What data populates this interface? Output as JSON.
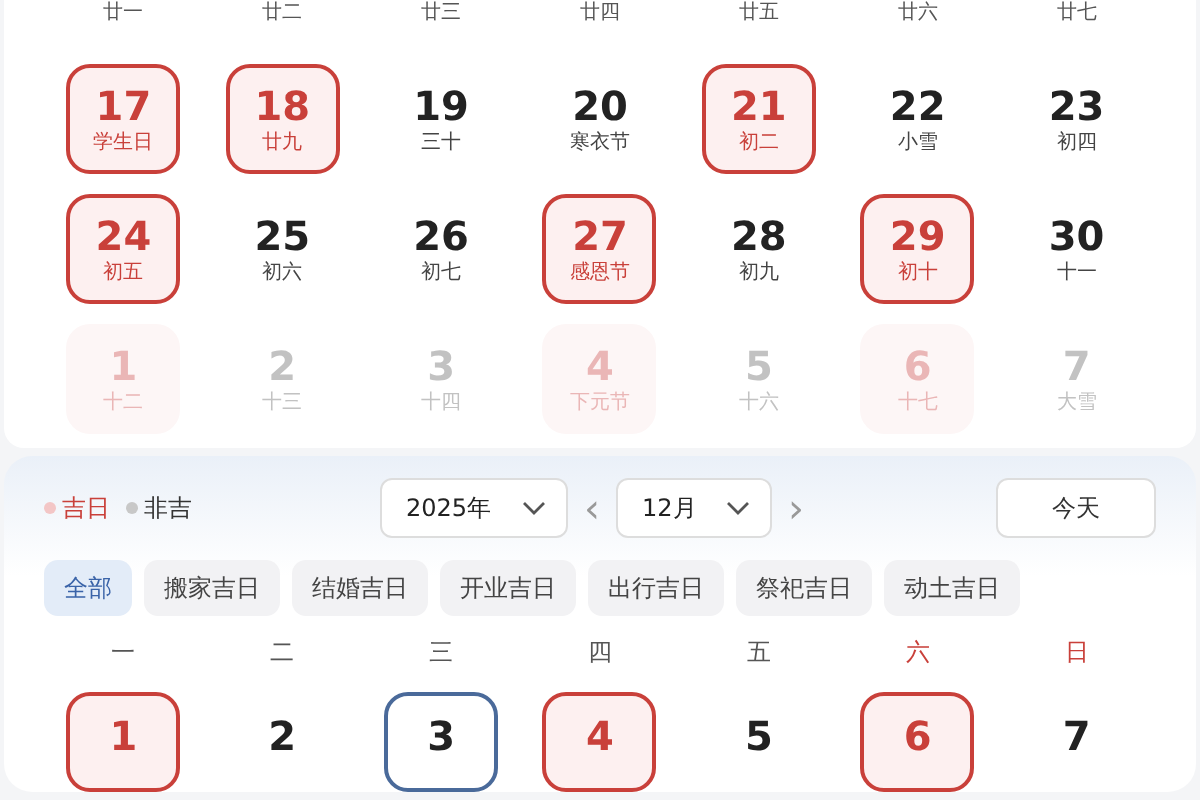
{
  "prev_month": {
    "top_lunar": [
      "廿一",
      "廿二",
      "廿三",
      "廿四",
      "廿五",
      "廿六",
      "廿七"
    ],
    "weeks": [
      [
        {
          "day": "17",
          "lunar": "学生日",
          "auspicious": true,
          "outside": false,
          "today": false
        },
        {
          "day": "18",
          "lunar": "廿九",
          "auspicious": true,
          "outside": false,
          "today": false
        },
        {
          "day": "19",
          "lunar": "三十",
          "auspicious": false,
          "outside": false,
          "today": false
        },
        {
          "day": "20",
          "lunar": "寒衣节",
          "auspicious": false,
          "outside": false,
          "today": false
        },
        {
          "day": "21",
          "lunar": "初二",
          "auspicious": true,
          "outside": false,
          "today": false
        },
        {
          "day": "22",
          "lunar": "小雪",
          "auspicious": false,
          "outside": false,
          "today": false
        },
        {
          "day": "23",
          "lunar": "初四",
          "auspicious": false,
          "outside": false,
          "today": false
        }
      ],
      [
        {
          "day": "24",
          "lunar": "初五",
          "auspicious": true,
          "outside": false,
          "today": false
        },
        {
          "day": "25",
          "lunar": "初六",
          "auspicious": false,
          "outside": false,
          "today": false
        },
        {
          "day": "26",
          "lunar": "初七",
          "auspicious": false,
          "outside": false,
          "today": false
        },
        {
          "day": "27",
          "lunar": "感恩节",
          "auspicious": true,
          "outside": false,
          "today": false
        },
        {
          "day": "28",
          "lunar": "初九",
          "auspicious": false,
          "outside": false,
          "today": false
        },
        {
          "day": "29",
          "lunar": "初十",
          "auspicious": true,
          "outside": false,
          "today": false
        },
        {
          "day": "30",
          "lunar": "十一",
          "auspicious": false,
          "outside": false,
          "today": false
        }
      ],
      [
        {
          "day": "1",
          "lunar": "十二",
          "auspicious": true,
          "outside": true,
          "today": false
        },
        {
          "day": "2",
          "lunar": "十三",
          "auspicious": false,
          "outside": true,
          "today": false
        },
        {
          "day": "3",
          "lunar": "十四",
          "auspicious": false,
          "outside": true,
          "today": false
        },
        {
          "day": "4",
          "lunar": "下元节",
          "auspicious": true,
          "outside": true,
          "today": false
        },
        {
          "day": "5",
          "lunar": "十六",
          "auspicious": false,
          "outside": true,
          "today": false
        },
        {
          "day": "6",
          "lunar": "十七",
          "auspicious": true,
          "outside": true,
          "today": false
        },
        {
          "day": "7",
          "lunar": "大雪",
          "auspicious": false,
          "outside": true,
          "today": false
        }
      ]
    ]
  },
  "calendar": {
    "legend": [
      {
        "label": "吉日",
        "color": "#f3c6c6"
      },
      {
        "label": "非吉",
        "color": "#c8c8c8"
      }
    ],
    "year_select": "2025年",
    "prev_arrow": "‹",
    "month_select": "12月",
    "next_arrow": "›",
    "today_button": "今天",
    "filters": [
      {
        "label": "全部",
        "selected": true
      },
      {
        "label": "搬家吉日",
        "selected": false
      },
      {
        "label": "结婚吉日",
        "selected": false
      },
      {
        "label": "开业吉日",
        "selected": false
      },
      {
        "label": "出行吉日",
        "selected": false
      },
      {
        "label": "祭祀吉日",
        "selected": false
      },
      {
        "label": "动土吉日",
        "selected": false
      }
    ],
    "weekdays": [
      {
        "label": "一",
        "weekend": false
      },
      {
        "label": "二",
        "weekend": false
      },
      {
        "label": "三",
        "weekend": false
      },
      {
        "label": "四",
        "weekend": false
      },
      {
        "label": "五",
        "weekend": false
      },
      {
        "label": "六",
        "weekend": true
      },
      {
        "label": "日",
        "weekend": true
      }
    ],
    "days": [
      {
        "day": "1",
        "auspicious": true,
        "today": false
      },
      {
        "day": "2",
        "auspicious": false,
        "today": false
      },
      {
        "day": "3",
        "auspicious": false,
        "today": true
      },
      {
        "day": "4",
        "auspicious": true,
        "today": false
      },
      {
        "day": "5",
        "auspicious": false,
        "today": false
      },
      {
        "day": "6",
        "auspicious": true,
        "today": false
      },
      {
        "day": "7",
        "auspicious": false,
        "today": false
      }
    ]
  }
}
